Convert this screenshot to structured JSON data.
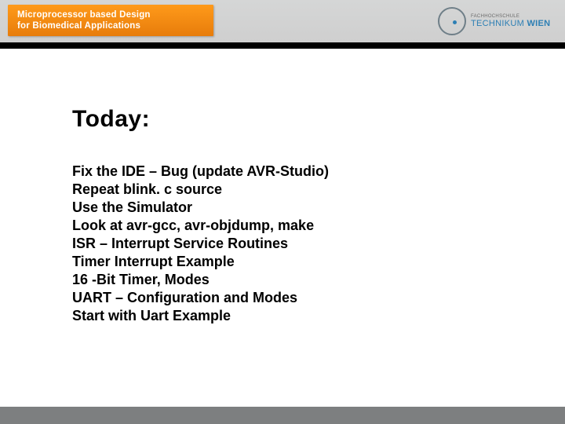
{
  "header": {
    "course_line1": "Microprocessor based Design",
    "course_line2": "for Biomedical Applications",
    "brand_top": "FACHHOCHSCHULE",
    "brand_main_a": "TECHNIKUM",
    "brand_main_b": "WIEN"
  },
  "title": "Today:",
  "items": [
    "Fix the IDE – Bug (update AVR-Studio)",
    "Repeat blink. c source",
    "Use the Simulator",
    "Look at avr-gcc, avr-objdump, make",
    "ISR – Interrupt Service Routines",
    "Timer Interrupt Example",
    "16 -Bit Timer, Modes",
    "UART – Configuration and Modes",
    "Start with Uart Example"
  ]
}
